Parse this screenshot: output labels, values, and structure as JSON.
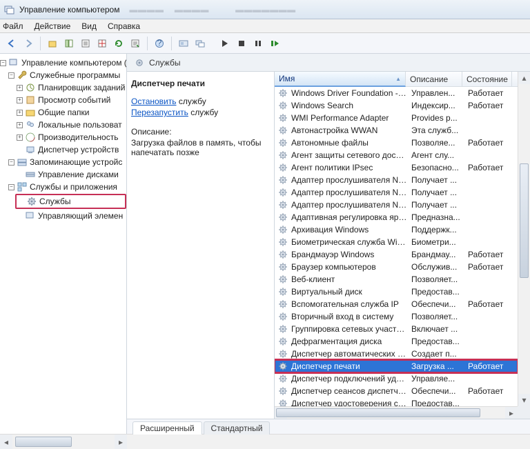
{
  "window": {
    "title": "Управление компьютером"
  },
  "menu": {
    "file": "Файл",
    "action": "Действие",
    "view": "Вид",
    "help": "Справка"
  },
  "tree": {
    "root": "Управление компьютером (л",
    "sys_tools": "Служебные программы",
    "scheduler": "Планировщик заданий",
    "eventvwr": "Просмотр событий",
    "shared": "Общие папки",
    "local_users": "Локальные пользоват",
    "perf": "Производительность",
    "devmgr": "Диспетчер устройств",
    "storage": "Запоминающие устройс",
    "diskmgr": "Управление дисками",
    "svc_apps": "Службы и приложения",
    "services": "Службы",
    "wmi": "Управляющий элемен"
  },
  "pane": {
    "title": "Службы",
    "service_name": "Диспетчер печати",
    "stop_verb": "Остановить",
    "restart_verb": "Перезапустить",
    "svc_word": " службу",
    "desc_label": "Описание:",
    "desc_text": "Загрузка файлов в память, чтобы напечатать позже"
  },
  "columns": {
    "name": "Имя",
    "description": "Описание",
    "state": "Состояние"
  },
  "tabs": {
    "ext": "Расширенный",
    "std": "Стандартный"
  },
  "services": [
    {
      "name": "Windows Driver Foundation - User...",
      "desc": "Управлен...",
      "state": "Работает"
    },
    {
      "name": "Windows Search",
      "desc": "Индексир...",
      "state": "Работает"
    },
    {
      "name": "WMI Performance Adapter",
      "desc": "Provides p...",
      "state": ""
    },
    {
      "name": "Автонастройка WWAN",
      "desc": "Эта служб...",
      "state": ""
    },
    {
      "name": "Автономные файлы",
      "desc": "Позволяе...",
      "state": "Работает"
    },
    {
      "name": "Агент защиты сетевого доступа",
      "desc": "Агент слу...",
      "state": ""
    },
    {
      "name": "Агент политики IPsec",
      "desc": "Безопасно...",
      "state": "Работает"
    },
    {
      "name": "Адаптер прослушивателя Net.M...",
      "desc": "Получает ...",
      "state": ""
    },
    {
      "name": "Адаптер прослушивателя Net.Pipe",
      "desc": "Получает ...",
      "state": ""
    },
    {
      "name": "Адаптер прослушивателя Net.Tcp",
      "desc": "Получает ...",
      "state": ""
    },
    {
      "name": "Адаптивная регулировка яркости",
      "desc": "Предназна...",
      "state": ""
    },
    {
      "name": "Архивация Windows",
      "desc": "Поддержк...",
      "state": ""
    },
    {
      "name": "Биометрическая служба Windows",
      "desc": "Биометри...",
      "state": ""
    },
    {
      "name": "Брандмауэр Windows",
      "desc": "Брандмау...",
      "state": "Работает"
    },
    {
      "name": "Браузер компьютеров",
      "desc": "Обслужив...",
      "state": "Работает"
    },
    {
      "name": "Веб-клиент",
      "desc": "Позволяет...",
      "state": ""
    },
    {
      "name": "Виртуальный диск",
      "desc": "Предостав...",
      "state": ""
    },
    {
      "name": "Вспомогательная служба IP",
      "desc": "Обеспечи...",
      "state": "Работает"
    },
    {
      "name": "Вторичный вход в систему",
      "desc": "Позволяет...",
      "state": ""
    },
    {
      "name": "Группировка сетевых участников",
      "desc": "Включает ...",
      "state": ""
    },
    {
      "name": "Дефрагментация диска",
      "desc": "Предостав...",
      "state": ""
    },
    {
      "name": "Диспетчер автоматических подк...",
      "desc": "Создает п...",
      "state": ""
    },
    {
      "name": "Диспетчер печати",
      "desc": "Загрузка ...",
      "state": "Работает",
      "selected": true,
      "highlight": true
    },
    {
      "name": "Диспетчер подключений удален...",
      "desc": "Управляе...",
      "state": ""
    },
    {
      "name": "Диспетчер сеансов диспетчера о...",
      "desc": "Обеспечи...",
      "state": "Работает"
    },
    {
      "name": "Диспетчер удостоверения сетев...",
      "desc": "Предостав...",
      "state": ""
    }
  ]
}
